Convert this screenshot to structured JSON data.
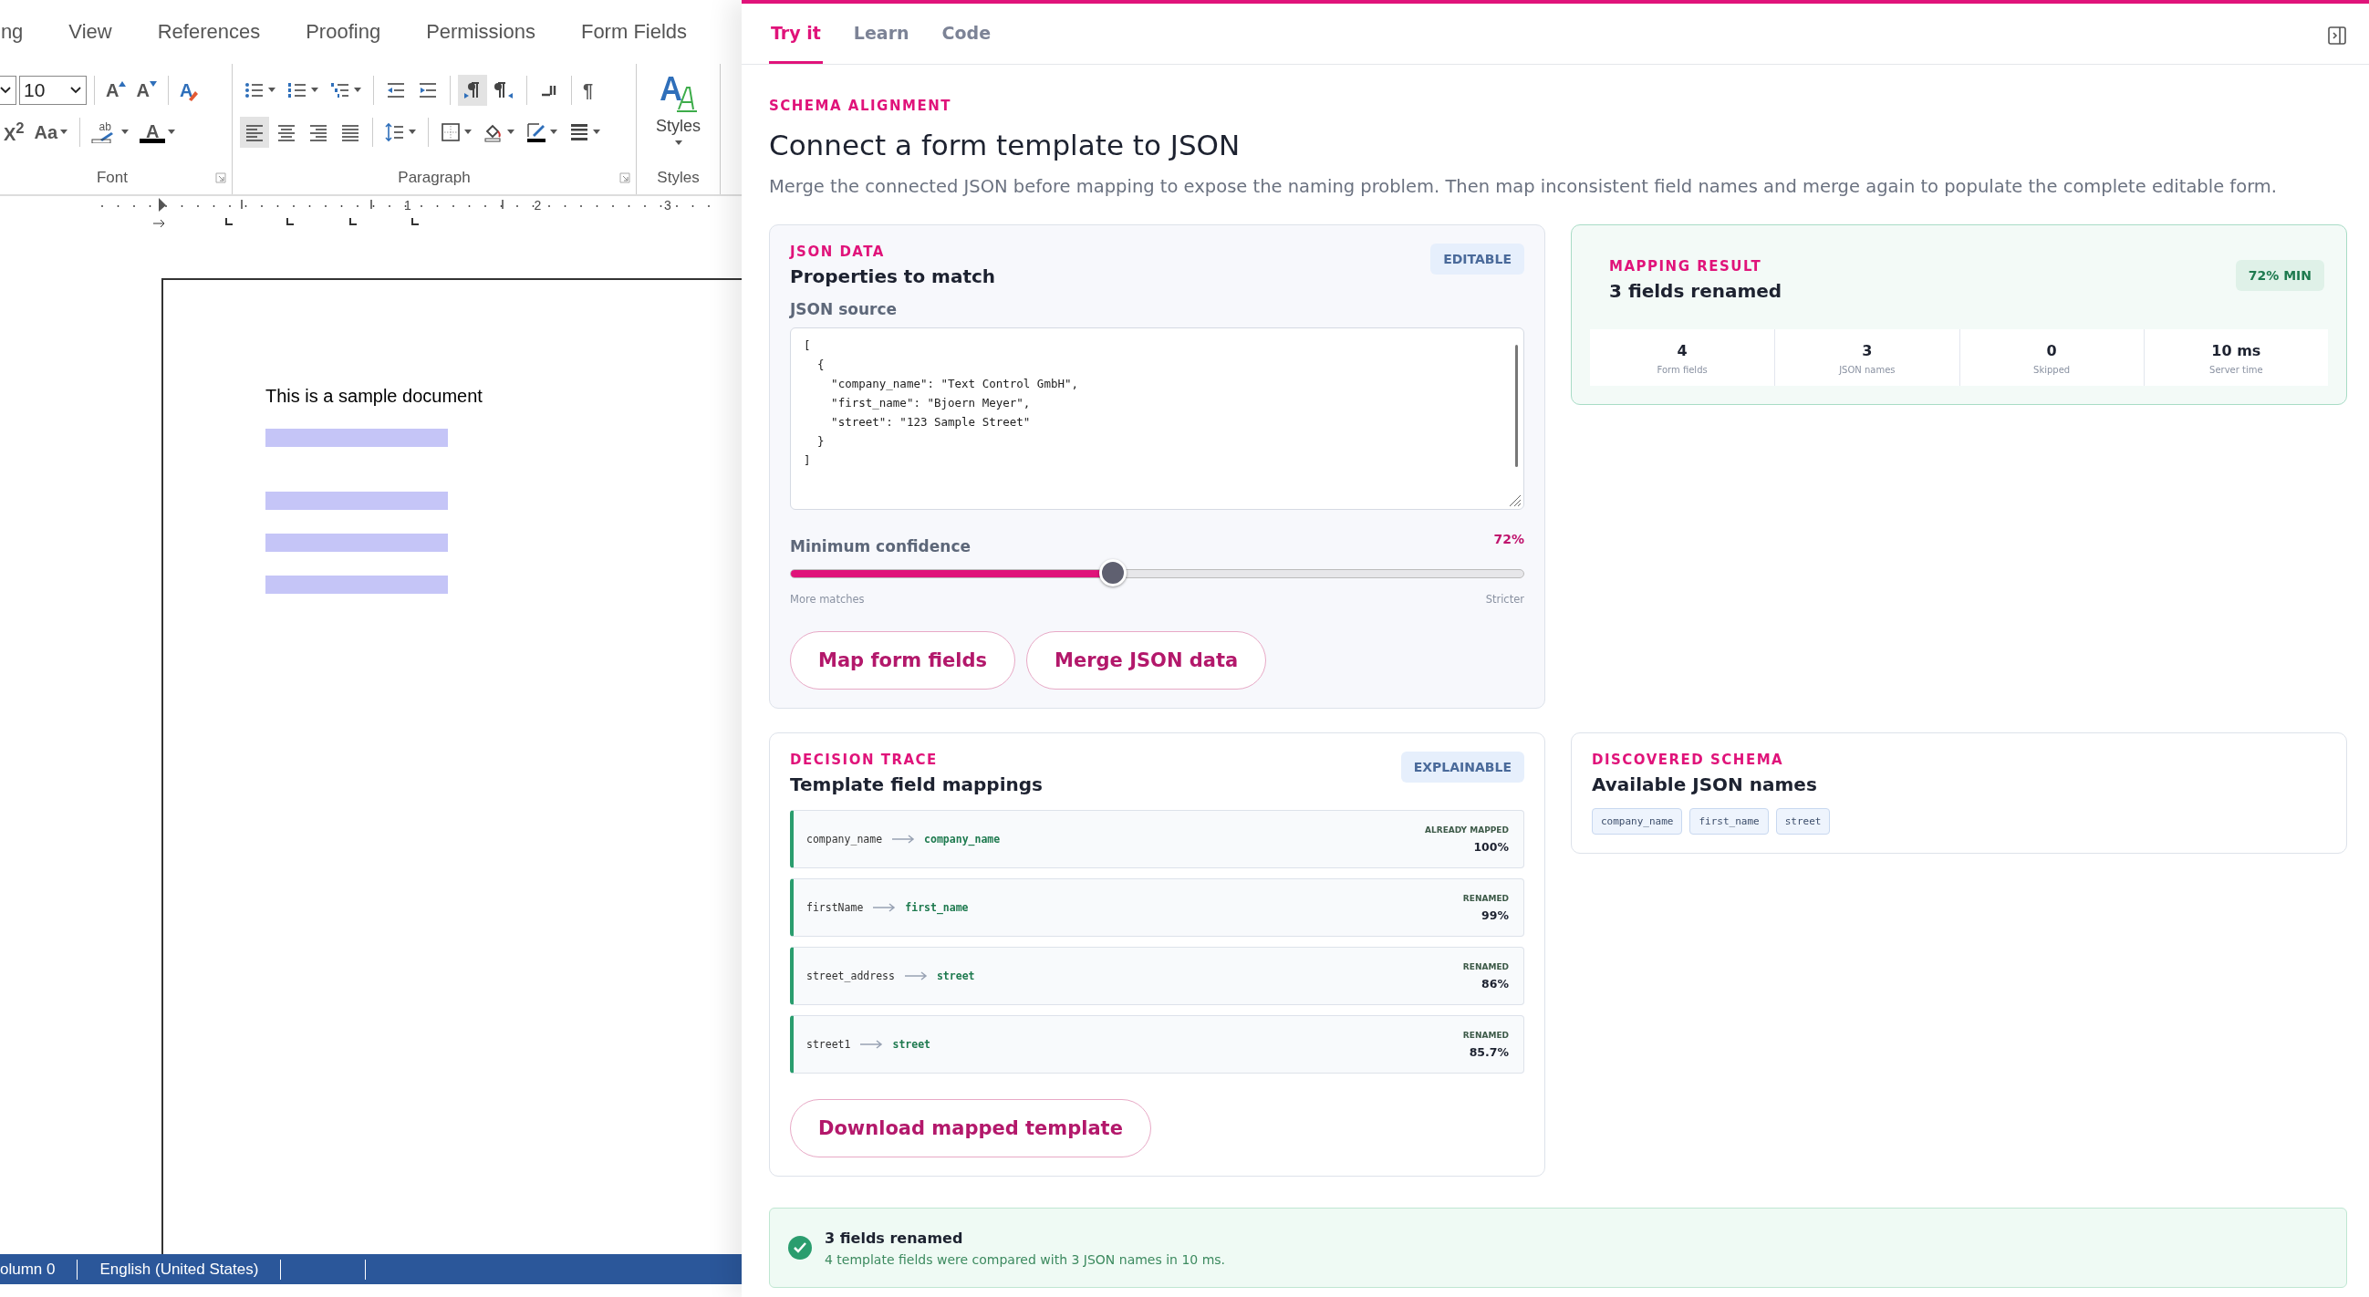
{
  "word": {
    "menu": [
      "ing",
      "View",
      "References",
      "Proofing",
      "Permissions",
      "Form Fields"
    ],
    "ribbon": {
      "groups": [
        {
          "kind": "tools",
          "label": "Font",
          "launcher": true,
          "rows": [
            [
              {
                "kind": "combo",
                "pressed": false,
                "dropdown": true
              },
              {
                "kind": "combo",
                "value": "10",
                "pressed": false,
                "dropdown": true
              },
              {
                "kind": "sep"
              },
              {
                "kind": "grow",
                "label": "A",
                "pressed": false,
                "dropdown": false
              },
              {
                "kind": "shrink",
                "label": "A",
                "pressed": false,
                "dropdown": false
              },
              {
                "kind": "sep"
              },
              {
                "kind": "clear",
                "label": "A",
                "pressed": false,
                "dropdown": false
              }
            ],
            [
              {
                "kind": "script",
                "label": "X$^{2}$",
                "pressed": false,
                "dropdown": false
              },
              {
                "kind": "case",
                "label": "Aa",
                "pressed": false,
                "dropdown": true
              },
              {
                "kind": "sep"
              },
              {
                "kind": "highlight",
                "label": "ab",
                "pressed": false,
                "dropdown": true
              },
              {
                "kind": "fontcolor",
                "label": "A",
                "pressed": false,
                "dropdown": true
              }
            ]
          ]
        },
        {
          "kind": "tools",
          "label": "Paragraph",
          "launcher": true,
          "rows": [
            [
              {
                "kind": "bullets",
                "pressed": false,
                "dropdown": true
              },
              {
                "kind": "numbering",
                "pressed": false,
                "dropdown": true
              },
              {
                "kind": "multilevel",
                "pressed": false,
                "dropdown": true
              },
              {
                "kind": "sep"
              },
              {
                "kind": "outdent",
                "pressed": false,
                "dropdown": false
              },
              {
                "kind": "indent",
                "pressed": false,
                "dropdown": false
              },
              {
                "kind": "sep"
              },
              {
                "kind": "ltr",
                "pressed": true,
                "dropdown": false
              },
              {
                "kind": "rtl",
                "pressed": false,
                "dropdown": false
              },
              {
                "kind": "sep"
              },
              {
                "kind": "corner",
                "pressed": false,
                "dropdown": false
              },
              {
                "kind": "sep"
              },
              {
                "kind": "marks",
                "label": "¶",
                "pressed": false,
                "dropdown": false
              }
            ],
            [
              {
                "kind": "left",
                "pressed": true,
                "dropdown": false
              },
              {
                "kind": "center",
                "pressed": false,
                "dropdown": false
              },
              {
                "kind": "right",
                "pressed": false,
                "dropdown": false
              },
              {
                "kind": "justify",
                "pressed": false,
                "dropdown": false
              },
              {
                "kind": "sep"
              },
              {
                "kind": "spacing",
                "pressed": false,
                "dropdown": true
              },
              {
                "kind": "sep"
              },
              {
                "kind": "borders",
                "pressed": false,
                "dropdown": true
              },
              {
                "kind": "shading",
                "pressed": false,
                "dropdown": true
              },
              {
                "kind": "pen",
                "pressed": false,
                "dropdown": true
              },
              {
                "kind": "lines",
                "pressed": false,
                "dropdown": true
              }
            ]
          ]
        },
        {
          "kind": "gallery",
          "label": "Styles",
          "button": "Styles"
        }
      ]
    },
    "ruler": [
      "1",
      "2",
      "3"
    ],
    "document": [
      {
        "kind": "text",
        "text": "This is a sample document"
      },
      {
        "kind": "field"
      },
      {
        "kind": "blank"
      },
      {
        "kind": "field"
      },
      {
        "kind": "field"
      },
      {
        "kind": "field"
      }
    ],
    "status_bar": [
      "olumn 0",
      "English (United States)"
    ]
  },
  "panel": {
    "tabs": [
      {
        "label": "Try it",
        "selected": true
      },
      {
        "label": "Learn",
        "selected": false
      },
      {
        "label": "Code",
        "selected": false
      }
    ],
    "eyebrow": "SCHEMA ALIGNMENT",
    "title": "Connect a form template to JSON",
    "description": "Merge the connected JSON before mapping to expose the naming problem. Then map inconsistent field names and merge again to populate the complete editable form.",
    "json_card": {
      "eyebrow": "JSON DATA",
      "title": "Properties to match",
      "badge": "EDITABLE",
      "source_label": "JSON source",
      "source": "[\n  {\n    \"company_name\": \"Text Control GmbH\",\n    \"first_name\": \"Bjoern Meyer\",\n    \"street\": \"123 Sample Street\"\n  }\n]",
      "confidence": {
        "label": "Minimum confidence",
        "reading": "72%",
        "level": 0.44,
        "min_label": "More matches",
        "max_label": "Stricter"
      },
      "buttons": [
        "Map form fields",
        "Merge JSON data"
      ]
    },
    "mapping_result": {
      "eyebrow": "MAPPING RESULT",
      "title": "3 fields renamed",
      "badge": "72% MIN",
      "stats": [
        {
          "value": "4",
          "label": "Form fields"
        },
        {
          "value": "3",
          "label": "JSON names"
        },
        {
          "value": "0",
          "label": "Skipped"
        },
        {
          "value": "10 ms",
          "label": "Server time"
        }
      ]
    },
    "decision_trace": {
      "eyebrow": "DECISION TRACE",
      "title": "Template field mappings",
      "badge": "EXPLAINABLE",
      "mappings": [
        {
          "from": "company_name",
          "to": "company_name",
          "status": "ALREADY MAPPED",
          "confidence": "100%"
        },
        {
          "from": "firstName",
          "to": "first_name",
          "status": "RENAMED",
          "confidence": "99%"
        },
        {
          "from": "street_address",
          "to": "street",
          "status": "RENAMED",
          "confidence": "86%"
        },
        {
          "from": "street1",
          "to": "street",
          "status": "RENAMED",
          "confidence": "85.7%"
        }
      ],
      "button": "Download mapped template"
    },
    "discovered": {
      "eyebrow": "DISCOVERED SCHEMA",
      "title": "Available JSON names",
      "names": [
        "company_name",
        "first_name",
        "street"
      ]
    },
    "banner": {
      "title": "3 fields renamed",
      "message": "4 template fields were compared with 3 JSON names in 10 ms."
    }
  }
}
